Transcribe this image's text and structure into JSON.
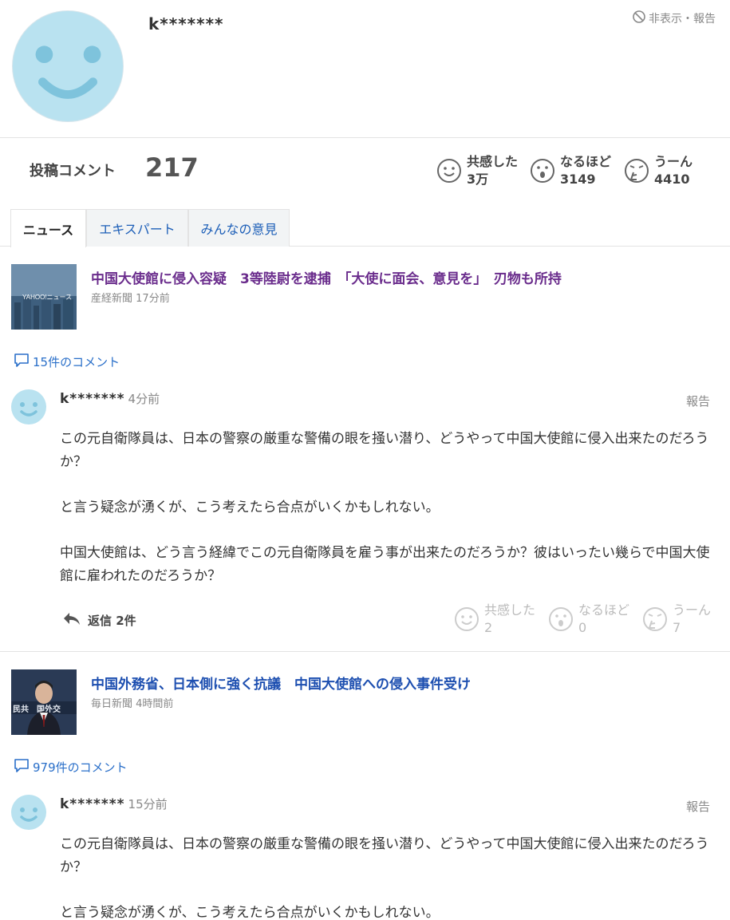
{
  "profile": {
    "username": "k*******",
    "hide_report_label": "非表示・報告"
  },
  "stats": {
    "post_label": "投稿コメント",
    "post_count": "217",
    "reactions": [
      {
        "icon": "smile-face-icon",
        "label": "共感した",
        "count": "3万"
      },
      {
        "icon": "surprised-face-icon",
        "label": "なるほど",
        "count": "3149"
      },
      {
        "icon": "thinking-face-icon",
        "label": "うーん",
        "count": "4410"
      }
    ]
  },
  "tabs": [
    {
      "label": "ニュース",
      "active": true
    },
    {
      "label": "エキスパート",
      "active": false
    },
    {
      "label": "みんなの意見",
      "active": false
    }
  ],
  "entries": [
    {
      "article": {
        "thumb_icon": "yahoo-news-thumbnail",
        "thumb_text": "YAHOO!ニュース",
        "title": "中国大使館に侵入容疑　3等陸尉を逮捕　「大使に面会、意見を」　刃物も所持",
        "title_color": "#6a2c8c",
        "source": "産経新聞",
        "time": "17分前"
      },
      "comments_link": "15件のコメント",
      "comment": {
        "user": "k*******",
        "time": "4分前",
        "report": "報告",
        "paragraphs": [
          "この元自衛隊員は、日本の警察の厳重な警備の眼を掻い潜り、どうやって中国大使館に侵入出来たのだろうか？",
          "と言う疑念が湧くが、こう考えたら合点がいくかもしれない。",
          "中国大使館は、どう言う経緯でこの元自衛隊員を雇う事が出来たのだろうか？彼はいったい幾らで中国大使館に雇われたのだろうか？"
        ],
        "reply": "返信 2件",
        "reactions": [
          {
            "label": "共感した",
            "count": "2"
          },
          {
            "label": "なるほど",
            "count": "0"
          },
          {
            "label": "うーん",
            "count": "7"
          }
        ]
      }
    },
    {
      "article": {
        "thumb_icon": "press-conference-thumbnail",
        "thumb_text": "民共　国外交",
        "title": "中国外務省、日本側に強く抗議　中国大使館への侵入事件受け",
        "title_color": "#1d4fb0",
        "source": "毎日新聞",
        "time": "4時間前"
      },
      "comments_link": "979件のコメント",
      "comment": {
        "user": "k*******",
        "time": "15分前",
        "report": "報告",
        "paragraphs": [
          "この元自衛隊員は、日本の警察の厳重な警備の眼を掻い潜り、どうやって中国大使館に侵入出来たのだろうか？",
          "と言う疑念が湧くが、こう考えたら合点がいくかもしれない。"
        ]
      }
    }
  ]
}
